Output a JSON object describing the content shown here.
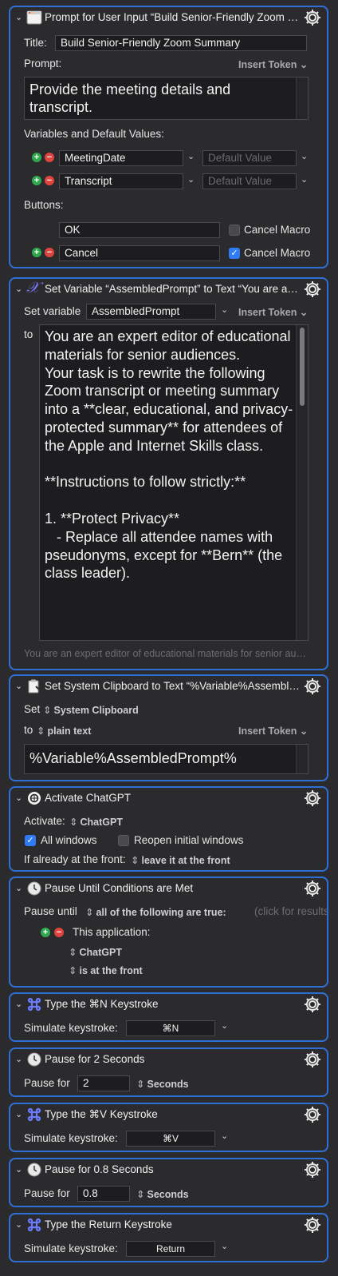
{
  "actions": {
    "prompt": {
      "title": "Prompt for User Input “Build Senior-Friendly Zoom Summary”",
      "title_label": "Title:",
      "title_value": "Build Senior-Friendly Zoom Summary",
      "prompt_label": "Prompt:",
      "insert_token": "Insert Token",
      "prompt_text": "Provide the meeting details and transcript.",
      "variables_label": "Variables and Default Values:",
      "variables": [
        {
          "name": "MeetingDate",
          "default_placeholder": "Default Value"
        },
        {
          "name": "Transcript",
          "default_placeholder": "Default Value"
        }
      ],
      "buttons_label": "Buttons:",
      "buttons": [
        {
          "name": "OK",
          "cancel_label": "Cancel Macro",
          "cancel_checked": false
        },
        {
          "name": "Cancel",
          "cancel_label": "Cancel Macro",
          "cancel_checked": true
        }
      ]
    },
    "set_variable": {
      "title": "Set Variable “AssembledPrompt” to Text “You are an expert editor of educational materials for senior audiences.”",
      "set_variable_label": "Set variable",
      "variable_name": "AssembledPrompt",
      "insert_token": "Insert Token",
      "to_label": "to",
      "text": "You are an expert editor of educational materials for senior audiences.\nYour task is to rewrite the following Zoom transcript or meeting summary into a **clear, educational, and privacy-protected summary** for attendees of the Apple and Internet Skills class.\n\n**Instructions to follow strictly:**\n\n1. **Protect Privacy**\n   - Replace all attendee names with pseudonyms, except for **Bern** (the class leader).",
      "preview": "You are an expert editor of educational materials for senior audiences."
    },
    "clipboard": {
      "title": "Set System Clipboard to Text “%Variable%AssembledPrompt%”",
      "set_label": "Set",
      "clipboard": "System Clipboard",
      "to_label": "to",
      "format": "plain text",
      "insert_token": "Insert Token",
      "text": "%Variable%AssembledPrompt%"
    },
    "activate": {
      "title": "Activate ChatGPT",
      "activate_label": "Activate:",
      "app": "ChatGPT",
      "all_windows_label": "All windows",
      "all_windows_checked": true,
      "reopen_label": "Reopen initial windows",
      "reopen_checked": false,
      "front_label": "If already at the front:",
      "front_value": "leave it at the front"
    },
    "pause_until": {
      "title": "Pause Until Conditions are Met",
      "pause_until_label": "Pause until",
      "condition_mode": "all of the following are true:",
      "hint": "(click for results)",
      "condition_label": "This application:",
      "condition_app": "ChatGPT",
      "condition_state": "is at the front"
    },
    "type_cmd_n": {
      "title": "Type the ⌘N Keystroke",
      "label": "Simulate keystroke:",
      "key": "⌘N"
    },
    "pause_2": {
      "title": "Pause for 2 Seconds",
      "label": "Pause for",
      "value": "2",
      "unit": "Seconds"
    },
    "type_cmd_v": {
      "title": "Type the ⌘V Keystroke",
      "label": "Simulate keystroke:",
      "key": "⌘V"
    },
    "pause_08": {
      "title": "Pause for 0.8 Seconds",
      "label": "Pause for",
      "value": "0.8",
      "unit": "Seconds"
    },
    "type_return": {
      "title": "Type the Return Keystroke",
      "label": "Simulate keystroke:",
      "key": "Return"
    }
  },
  "icons": {
    "gear": "gear-icon",
    "collapse": "chevron-down-icon",
    "command": "command-key-icon",
    "clock": "clock-icon",
    "variable": "variable-x-icon",
    "window": "window-icon",
    "clipboard": "clipboard-icon",
    "chatgpt": "chatgpt-icon"
  },
  "colors": {
    "accent_border": "#2f6fd6",
    "background": "#2b2b2d",
    "field_background": "#1d1d1f",
    "plus_green": "#2fa84f",
    "minus_red": "#e0443e",
    "checkbox_blue": "#2f7bf5",
    "command_icon": "#6b7cff"
  }
}
